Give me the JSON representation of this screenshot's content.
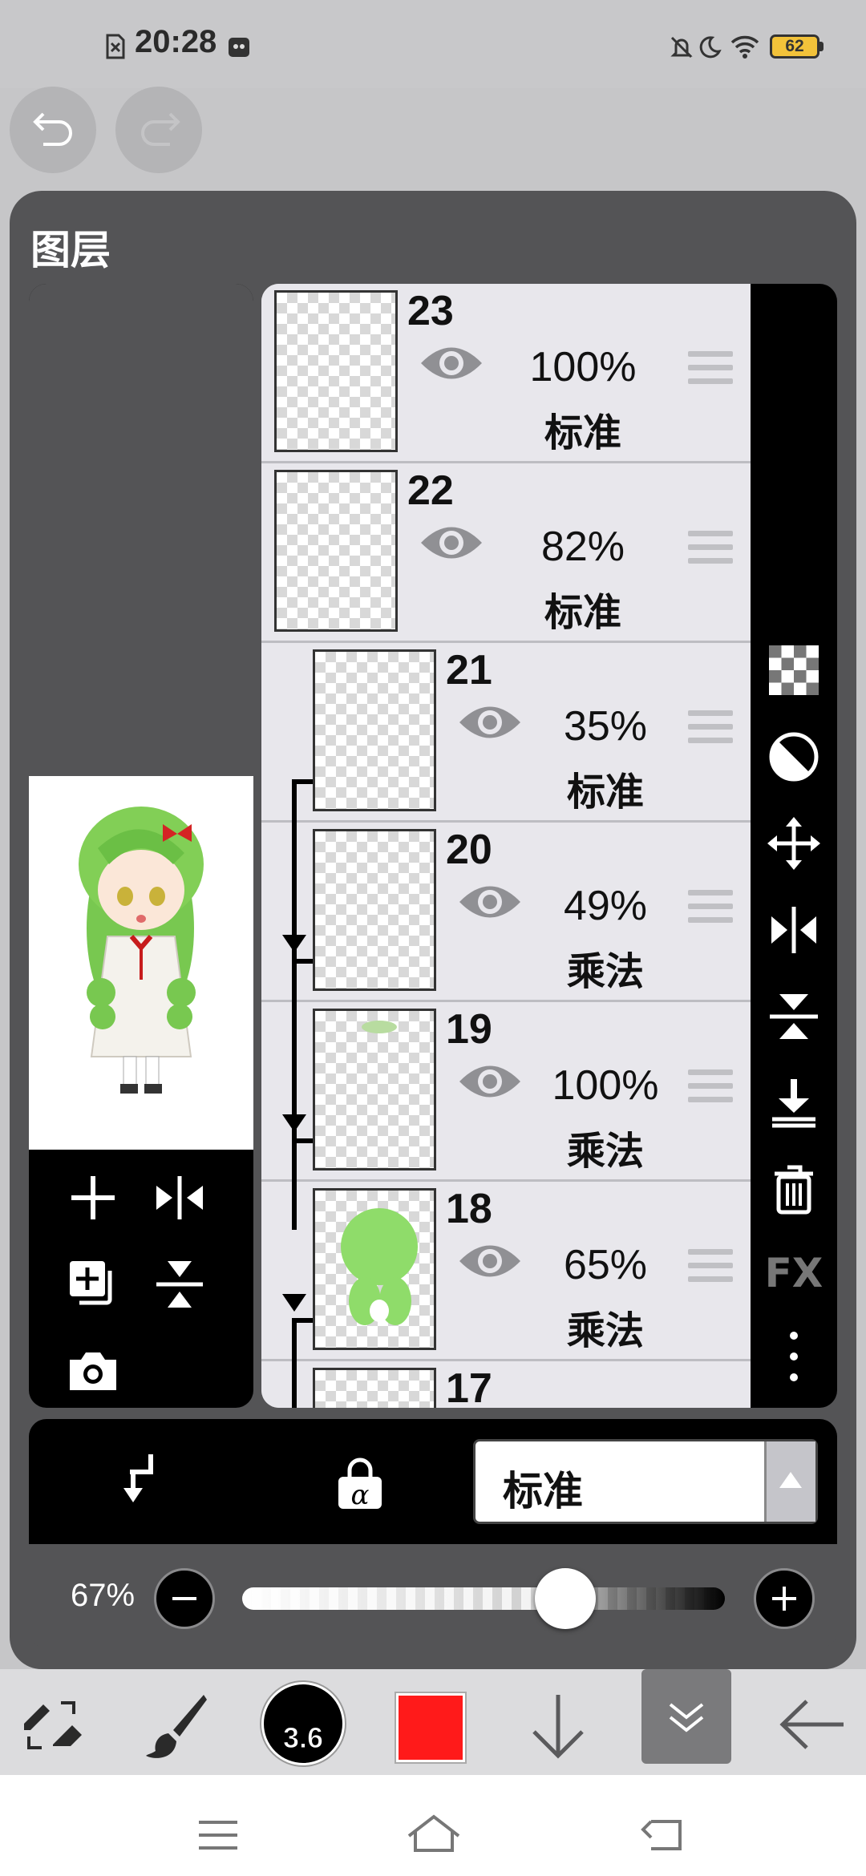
{
  "status_bar": {
    "time": "20:28",
    "battery": "62"
  },
  "panel": {
    "title": "图层"
  },
  "layers": [
    {
      "num": "23",
      "opacity": "100%",
      "mode": "标准"
    },
    {
      "num": "22",
      "opacity": "82%",
      "mode": "标准"
    },
    {
      "num": "21",
      "opacity": "35%",
      "mode": "标准"
    },
    {
      "num": "20",
      "opacity": "49%",
      "mode": "乘法"
    },
    {
      "num": "19",
      "opacity": "100%",
      "mode": "乘法"
    },
    {
      "num": "18",
      "opacity": "65%",
      "mode": "乘法"
    },
    {
      "num": "17",
      "opacity": "",
      "mode": ""
    }
  ],
  "right_toolbar": {
    "fx_label": "FX"
  },
  "blend": {
    "mode_label": "标准"
  },
  "opacity_control": {
    "value_label": "67%",
    "value": 0.67
  },
  "bottom_toolbar": {
    "brush_size": "3.6",
    "color": "#ff1a1a"
  },
  "colors": {
    "panel": "#545456",
    "list_bg": "#e8e7ec",
    "accent_red": "#ff1a1a"
  },
  "icons": {
    "undo": "undo-icon",
    "redo": "redo-icon",
    "add": "plus-icon",
    "flip_h": "flip-horizontal-icon",
    "copy": "duplicate-icon",
    "flip_v": "flip-vertical-icon",
    "camera": "camera-icon",
    "checker": "transparency-icon",
    "contrast": "contrast-icon",
    "move": "move-icon",
    "merge": "merge-down-icon",
    "delete": "trash-icon",
    "more": "more-vertical-icon"
  }
}
